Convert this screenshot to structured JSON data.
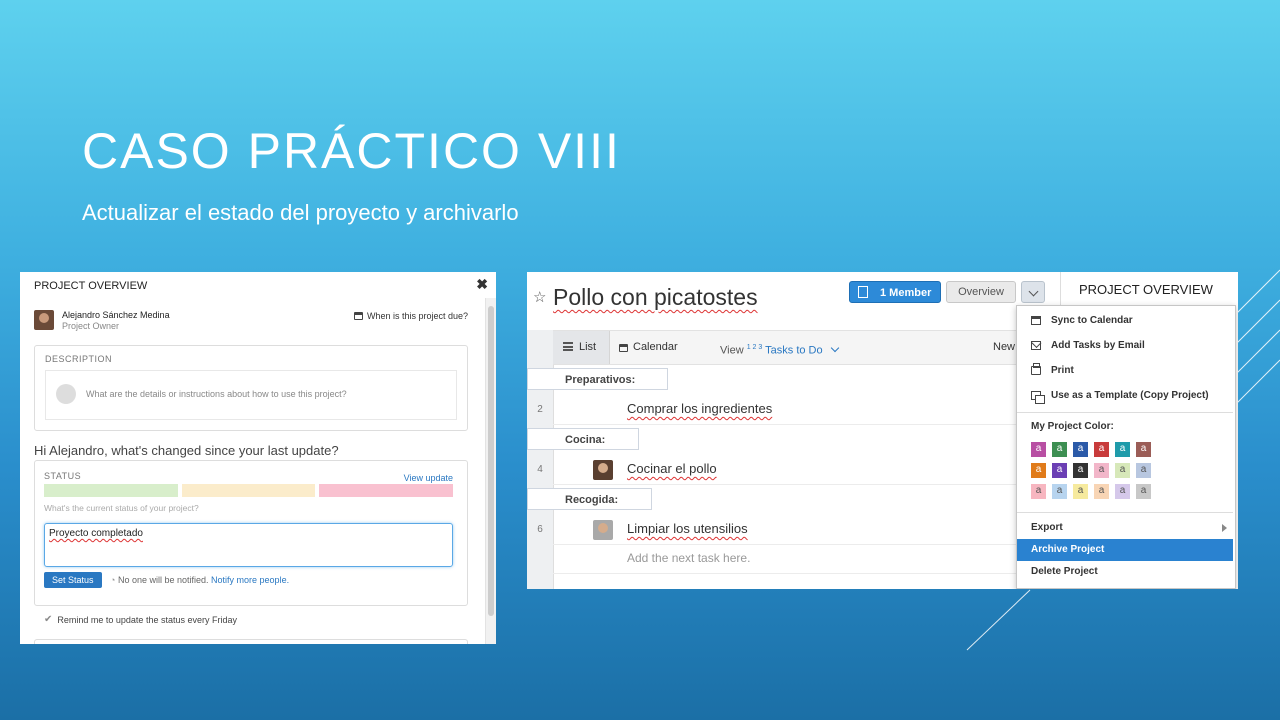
{
  "slide": {
    "title": "CASO PRÁCTICO VIII",
    "subtitle": "Actualizar el estado del proyecto y archivarlo"
  },
  "left_panel": {
    "header": "PROJECT OVERVIEW",
    "close_icon": "✖",
    "owner_name": "Alejandro Sánchez Medina",
    "owner_role": "Project Owner",
    "due_label": "When is this project due?",
    "description_label": "DESCRIPTION",
    "description_placeholder": "What are the details or instructions about how to use this project?",
    "question": "Hi Alejandro, what's changed since your last update?",
    "status_label": "STATUS",
    "view_update": "View update",
    "status_colors": [
      "#d8eecb",
      "#fbeccb",
      "#f9c1d0"
    ],
    "status_hint": "What's the current status of your project?",
    "status_value": "Proyecto completado",
    "set_status_button": "Set Status",
    "notify_text": "No one will be notified.",
    "notify_link": "Notify more people.",
    "remind_text": "Remind me to update the status every Friday"
  },
  "right_panel": {
    "project_title": "Pollo con picatostes",
    "member_button": "1 Member",
    "overview_button": "Overview",
    "side_title": "PROJECT OVERVIEW",
    "tabs": {
      "list": "List",
      "calendar": "Calendar"
    },
    "view_label": "View",
    "view_sup": "1 2 3",
    "view_filter": "Tasks to Do",
    "new_label": "New",
    "sections": [
      {
        "name": "Preparativos:",
        "rownum": "2",
        "task": "Comprar los ingredientes"
      },
      {
        "name": "Cocina:",
        "rownum": "4",
        "task": "Cocinar el pollo"
      },
      {
        "name": "Recogida:",
        "rownum": "6",
        "task": "Limpiar los utensilios"
      }
    ],
    "add_task_placeholder": "Add the next task here.",
    "menu": {
      "items": [
        "Sync to Calendar",
        "Add Tasks by Email",
        "Print",
        "Use as a Template (Copy Project)"
      ],
      "color_label": "My Project Color:",
      "swatch_letter": "a",
      "swatches": [
        [
          "#b84fa3",
          "#3d8f52",
          "#2b5aa8",
          "#c83b3b",
          "#1f9baa",
          "#9b5d57"
        ],
        [
          "#e07b1a",
          "#6b3fb4",
          "#333333",
          "#f2b6c9",
          "#d7e8b9",
          "#b8c7e0"
        ],
        [
          "#f7b6c0",
          "#b7d4ef",
          "#f6ea9e",
          "#f8d5b5",
          "#d5c8ea",
          "#c8c8c8"
        ]
      ],
      "export": "Export",
      "archive": "Archive Project",
      "delete": "Delete Project",
      "active_color": "#2a82d0"
    }
  }
}
